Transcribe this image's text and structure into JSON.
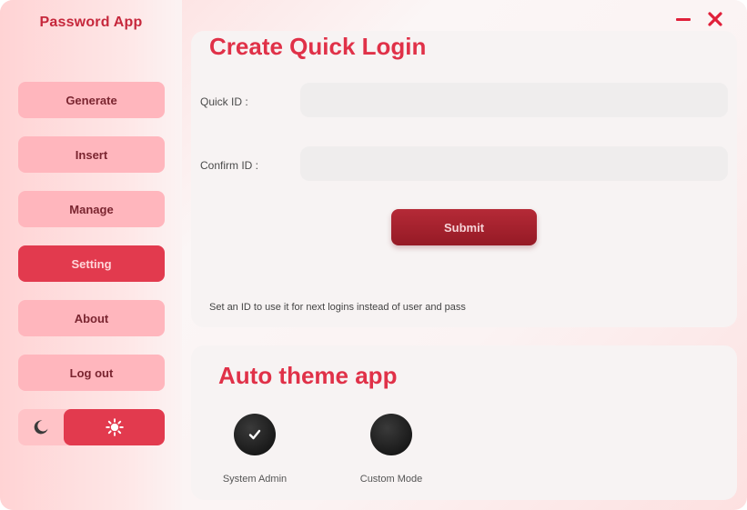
{
  "app": {
    "title": "Password App"
  },
  "sidebar": {
    "items": [
      {
        "label": "Generate",
        "active": false
      },
      {
        "label": "Insert",
        "active": false
      },
      {
        "label": "Manage",
        "active": false
      },
      {
        "label": "Setting",
        "active": true
      },
      {
        "label": "About",
        "active": false
      },
      {
        "label": "Log out",
        "active": false
      }
    ],
    "theme_toggle": {
      "left_icon": "moon-icon",
      "right_icon": "sun-icon",
      "selected": "light"
    }
  },
  "window_controls": {
    "minimize_icon": "minimize-icon",
    "close_icon": "close-icon"
  },
  "quick_login": {
    "title": "Create Quick Login",
    "quick_id_label": "Quick ID :",
    "quick_id_value": "",
    "confirm_id_label": "Confirm ID :",
    "confirm_id_value": "",
    "submit_label": "Submit",
    "hint": "Set an ID to use it for next logins instead of user and pass"
  },
  "auto_theme": {
    "title": "Auto theme app",
    "options": [
      {
        "label": "System Admin",
        "icon": "checkmark-icon"
      },
      {
        "label": "Custom Mode",
        "icon": ""
      }
    ]
  },
  "colors": {
    "accent": "#e03148",
    "sidebar_button": "#ffb6bd",
    "active_button": "#e23a4e",
    "submit_button": "#a8232f"
  }
}
